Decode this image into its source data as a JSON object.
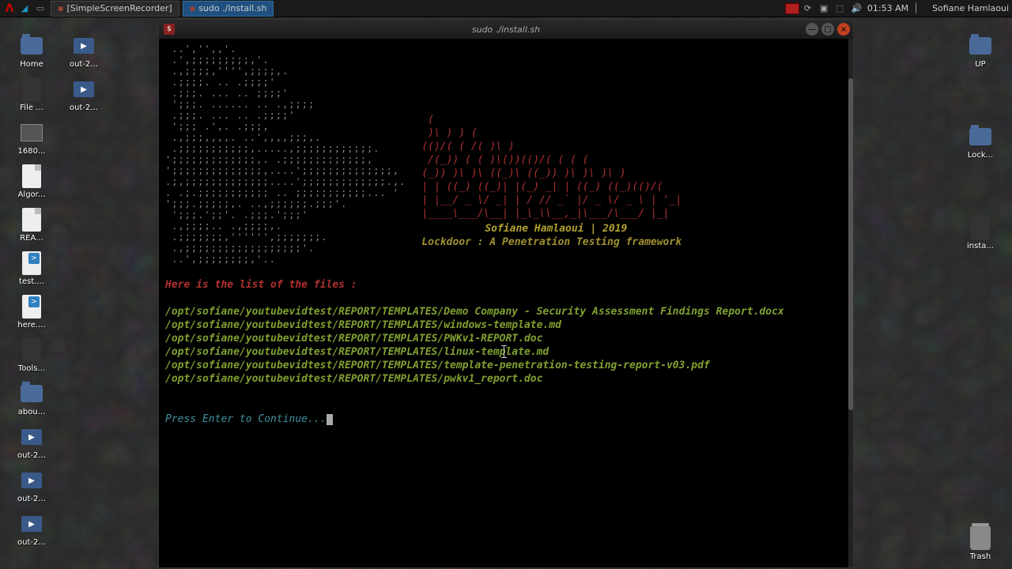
{
  "taskbar": {
    "apps": [
      {
        "label": "[SimpleScreenRecorder]",
        "active": false
      },
      {
        "label": "sudo ./install.sh",
        "active": true
      }
    ],
    "clock": "01:53 AM",
    "user": "Sofiane Hamlaoui"
  },
  "desktop": {
    "left": [
      {
        "label": "Home",
        "kind": "folder"
      },
      {
        "label": "File ...",
        "kind": "file-dark"
      },
      {
        "label": "1680...",
        "kind": "img"
      },
      {
        "label": "Algor...",
        "kind": "file"
      },
      {
        "label": "REA...",
        "kind": "file"
      },
      {
        "label": "test....",
        "kind": "sh"
      },
      {
        "label": "here....",
        "kind": "sh"
      },
      {
        "label": "Tools...",
        "kind": "file-dark"
      },
      {
        "label": "abou...",
        "kind": "folder"
      },
      {
        "label": "out-2...",
        "kind": "vid"
      },
      {
        "label": "out-2...",
        "kind": "vid"
      },
      {
        "label": "out-2...",
        "kind": "vid"
      }
    ],
    "left_col2": [
      {
        "label": "out-2...",
        "kind": "vid"
      },
      {
        "label": "out-2...",
        "kind": "vid"
      }
    ],
    "right": [
      {
        "label": "UP",
        "kind": "folder"
      },
      {
        "label": "Lock...",
        "kind": "folder"
      },
      {
        "label": "insta...",
        "kind": "file-dark"
      }
    ],
    "right_bottom": [
      {
        "label": "Trash",
        "kind": "trash"
      }
    ]
  },
  "terminal": {
    "title": "sudo ./install.sh",
    "ascii_skull": " ..','',,'. \n .',;;;;;;;;;,'. \n .,;;;;,'''',;;;;,. \n .;;;;. .. .;;;;' \n .;;;. ... .. ;;;;' \n ';;;. ...... .. .,;;;; \n .;;;. ... .. .;;;;' \n ';;; .',. .;;;, \n .,;;;,,,,. ..',,,,;;;,. \n .;;;;;;;;;;;,.....,;;;;;;;;;;;;. \n';;;;;;;;;;;;;,. .;;;;;;;;;;;;;,\n';;;;;;;;;;;;;;,....';;;;;;;;;;;;;;,\n.;,;;;;;;;;;;;;;....';;;;;;;;;;;;;.,.\n. .;.;;;;;;;;;;; .. ;;;;;;;;;;;... ' \n';;;.;;;;;,. ..,;;;;;;.;;;'.\n ';;;.';;'. .;;;.';;;'\n .,;;;;.. .,;;;;,. \n .;;;;;;;,'''''',;;;;;;;. \n .,;;;;;;;;;;;;;;;;;;'. \n ..',;;;;;;;;,'.. ",
    "ascii_logo": " (\n )\\ ) ) (\n(()/( ( /( )\\ )\n /(_)) ( ( )\\())(()/( ( ( (\n(_)) )\\ )\\ ((_)\\ ((_)) )\\ )\\ )\\ )\n| | ((_) ((_)| |(_) _| | ((_) ((_)(()/(\n| |__/ _ \\/ _| | / // _` |/ _ \\/ _ \\ | '_|\n|____\\___/\\__| |_\\_\\\\__,_|\\___/\\___/ |_|",
    "author": "Sofiane Hamlaoui | 2019",
    "subtitle": "Lockdoor : A Penetration Testing framework",
    "list_header": "Here is the list of the files :",
    "files": [
      "/opt/sofiane/youtubevidtest/REPORT/TEMPLATES/Demo Company - Security Assessment Findings Report.docx",
      "/opt/sofiane/youtubevidtest/REPORT/TEMPLATES/windows-template.md",
      "/opt/sofiane/youtubevidtest/REPORT/TEMPLATES/PWKv1-REPORT.doc",
      "/opt/sofiane/youtubevidtest/REPORT/TEMPLATES/linux-template.md",
      "/opt/sofiane/youtubevidtest/REPORT/TEMPLATES/template-penetration-testing-report-v03.pdf",
      "/opt/sofiane/youtubevidtest/REPORT/TEMPLATES/pwkv1_report.doc"
    ],
    "prompt": "Press Enter to Continue..."
  }
}
